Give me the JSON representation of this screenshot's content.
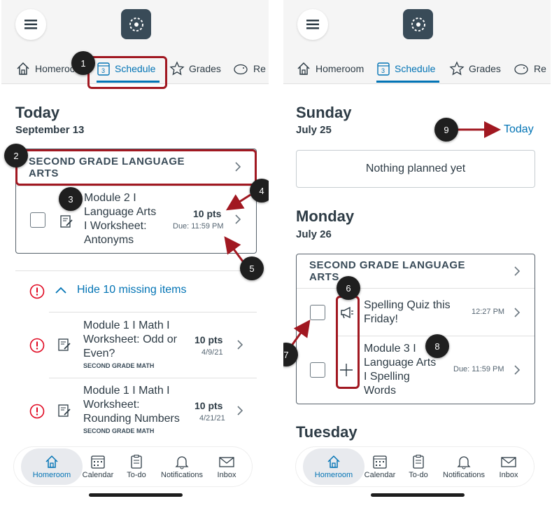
{
  "tabs": {
    "homeroom": "Homeroom",
    "schedule": "Schedule",
    "grades": "Grades",
    "resources": "Re"
  },
  "left": {
    "day": "Today",
    "date": "September 13",
    "course": "SECOND GRADE LANGUAGE ARTS",
    "course_l1": "SECOND GRADE LANGUAGE",
    "course_l2": "ARTS",
    "item": {
      "t1": "Module 2 I",
      "t2": "Language Arts",
      "t3": "I Worksheet:",
      "t4": "Antonyms",
      "pts": "10 pts",
      "due": "Due: 11:59 PM"
    },
    "missing_label": "Hide 10 missing items",
    "missing": [
      {
        "t1": "Module 1 I Math I",
        "t2": "Worksheet: Odd or",
        "t3": "Even?",
        "course": "SECOND GRADE MATH",
        "pts": "10 pts",
        "date": "4/9/21"
      },
      {
        "t1": "Module 1 I Math I",
        "t2": "Worksheet:",
        "t3": "Rounding Numbers",
        "course": "SECOND GRADE MATH",
        "pts": "10 pts",
        "date": "4/21/21"
      }
    ]
  },
  "right": {
    "day1": "Sunday",
    "date1": "July 25",
    "today_link": "Today",
    "nothing": "Nothing planned yet",
    "day2": "Monday",
    "date2": "July 26",
    "course_l1": "SECOND GRADE LANGUAGE",
    "course_l2": "ARTS",
    "item1": {
      "t1": "Spelling Quiz this",
      "t2": "Friday!",
      "time": "12:27 PM"
    },
    "item2": {
      "t1": "Module 3 I",
      "t2": "Language Arts",
      "t3": "I Spelling",
      "t4": "Words",
      "due": "Due: 11:59 PM"
    },
    "day3": "Tuesday"
  },
  "nav": {
    "homeroom": "Homeroom",
    "calendar": "Calendar",
    "todo": "To-do",
    "notifications": "Notifications",
    "inbox": "Inbox"
  },
  "callouts": [
    "1",
    "2",
    "3",
    "4",
    "5",
    "6",
    "7",
    "8",
    "9"
  ],
  "colors": {
    "accent": "#0374b5",
    "highlight": "#a11821",
    "missing": "#e0061f"
  }
}
